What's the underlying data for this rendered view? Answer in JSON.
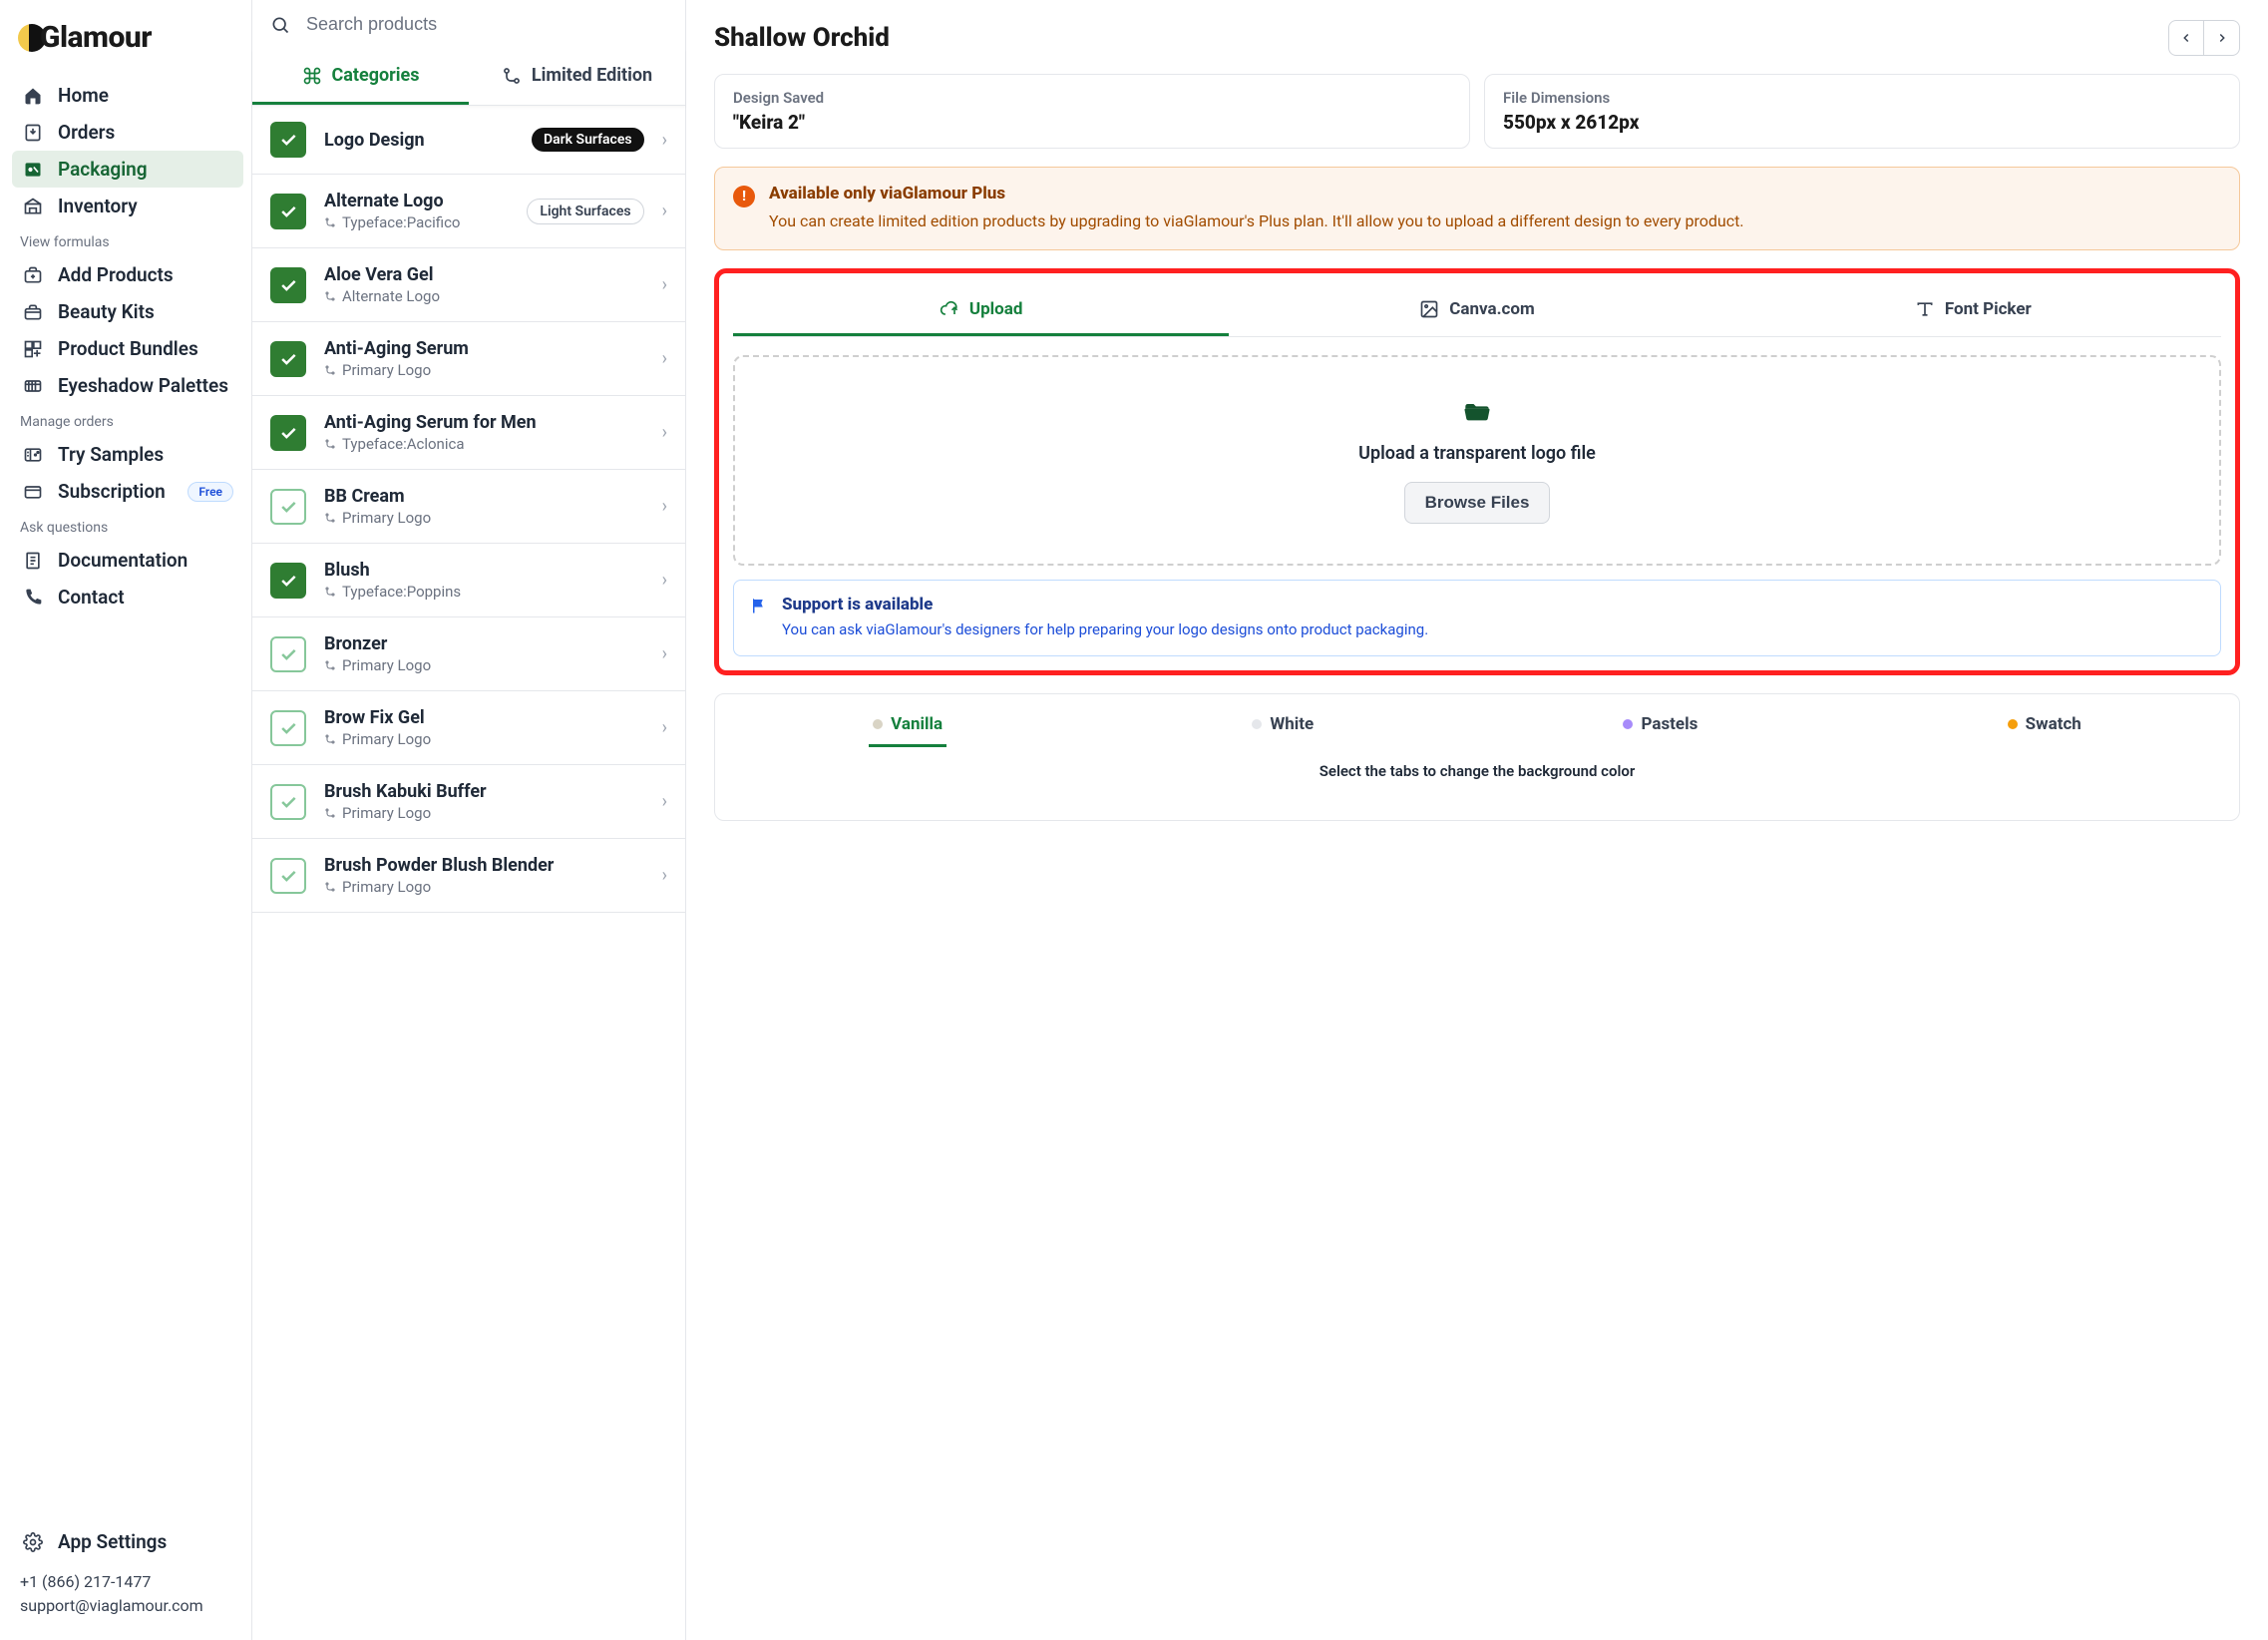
{
  "brand": "Glamour",
  "sidebar": {
    "main": [
      {
        "label": "Home"
      },
      {
        "label": "Orders"
      },
      {
        "label": "Packaging"
      },
      {
        "label": "Inventory"
      }
    ],
    "sections": [
      {
        "heading": "View formulas",
        "items": [
          {
            "label": "Add Products"
          },
          {
            "label": "Beauty Kits"
          },
          {
            "label": "Product Bundles"
          },
          {
            "label": "Eyeshadow Palettes"
          }
        ]
      },
      {
        "heading": "Manage orders",
        "items": [
          {
            "label": "Try Samples"
          },
          {
            "label": "Subscription",
            "badge": "Free"
          }
        ]
      },
      {
        "heading": "Ask questions",
        "items": [
          {
            "label": "Documentation"
          },
          {
            "label": "Contact"
          }
        ]
      }
    ],
    "settings": "App Settings",
    "phone": "+1 (866) 217-1477",
    "email": "support@viaglamour.com"
  },
  "search": {
    "placeholder": "Search products"
  },
  "mid_tabs": {
    "categories": "Categories",
    "limited": "Limited Edition"
  },
  "products": [
    {
      "title": "Logo Design",
      "sub": "",
      "pill": "Dark Surfaces",
      "pill_dark": true,
      "solid": true
    },
    {
      "title": "Alternate Logo",
      "sub": "Typeface:Pacifico",
      "pill": "Light Surfaces",
      "pill_dark": false,
      "solid": true
    },
    {
      "title": "Aloe Vera Gel",
      "sub": "Alternate Logo",
      "solid": true
    },
    {
      "title": "Anti-Aging Serum",
      "sub": "Primary Logo",
      "solid": true
    },
    {
      "title": "Anti-Aging Serum for Men",
      "sub": "Typeface:Aclonica",
      "solid": true
    },
    {
      "title": "BB Cream",
      "sub": "Primary Logo",
      "solid": false
    },
    {
      "title": "Blush",
      "sub": "Typeface:Poppins",
      "solid": true
    },
    {
      "title": "Bronzer",
      "sub": "Primary Logo",
      "solid": false
    },
    {
      "title": "Brow Fix Gel",
      "sub": "Primary Logo",
      "solid": false
    },
    {
      "title": "Brush Kabuki Buffer",
      "sub": "Primary Logo",
      "solid": false
    },
    {
      "title": "Brush Powder Blush Blender",
      "sub": "Primary Logo",
      "solid": false
    }
  ],
  "right": {
    "title": "Shallow Orchid",
    "cards": [
      {
        "label": "Design Saved",
        "value": "\"Keira 2\""
      },
      {
        "label": "File Dimensions",
        "value": "550px x 2612px"
      }
    ],
    "alert": {
      "title": "Available only viaGlamour Plus",
      "body": "You can create limited edition products by upgrading to viaGlamour's Plus plan. It'll allow you to upload a different design to every product."
    },
    "upload_tabs": {
      "upload": "Upload",
      "canva": "Canva.com",
      "font": "Font Picker"
    },
    "dropzone": {
      "text": "Upload a transparent logo file",
      "button": "Browse Files"
    },
    "support": {
      "title": "Support is available",
      "body": "You can ask viaGlamour's designers for help preparing your logo designs onto product packaging."
    },
    "variants": {
      "tabs": [
        {
          "label": "Vanilla",
          "color": "#d9d4c5",
          "active": true
        },
        {
          "label": "White",
          "color": "#e5e7eb"
        },
        {
          "label": "Pastels",
          "color": "#a78bfa"
        },
        {
          "label": "Swatch",
          "color": "#f59e0b"
        }
      ],
      "note": "Select the tabs to change the background color"
    }
  }
}
